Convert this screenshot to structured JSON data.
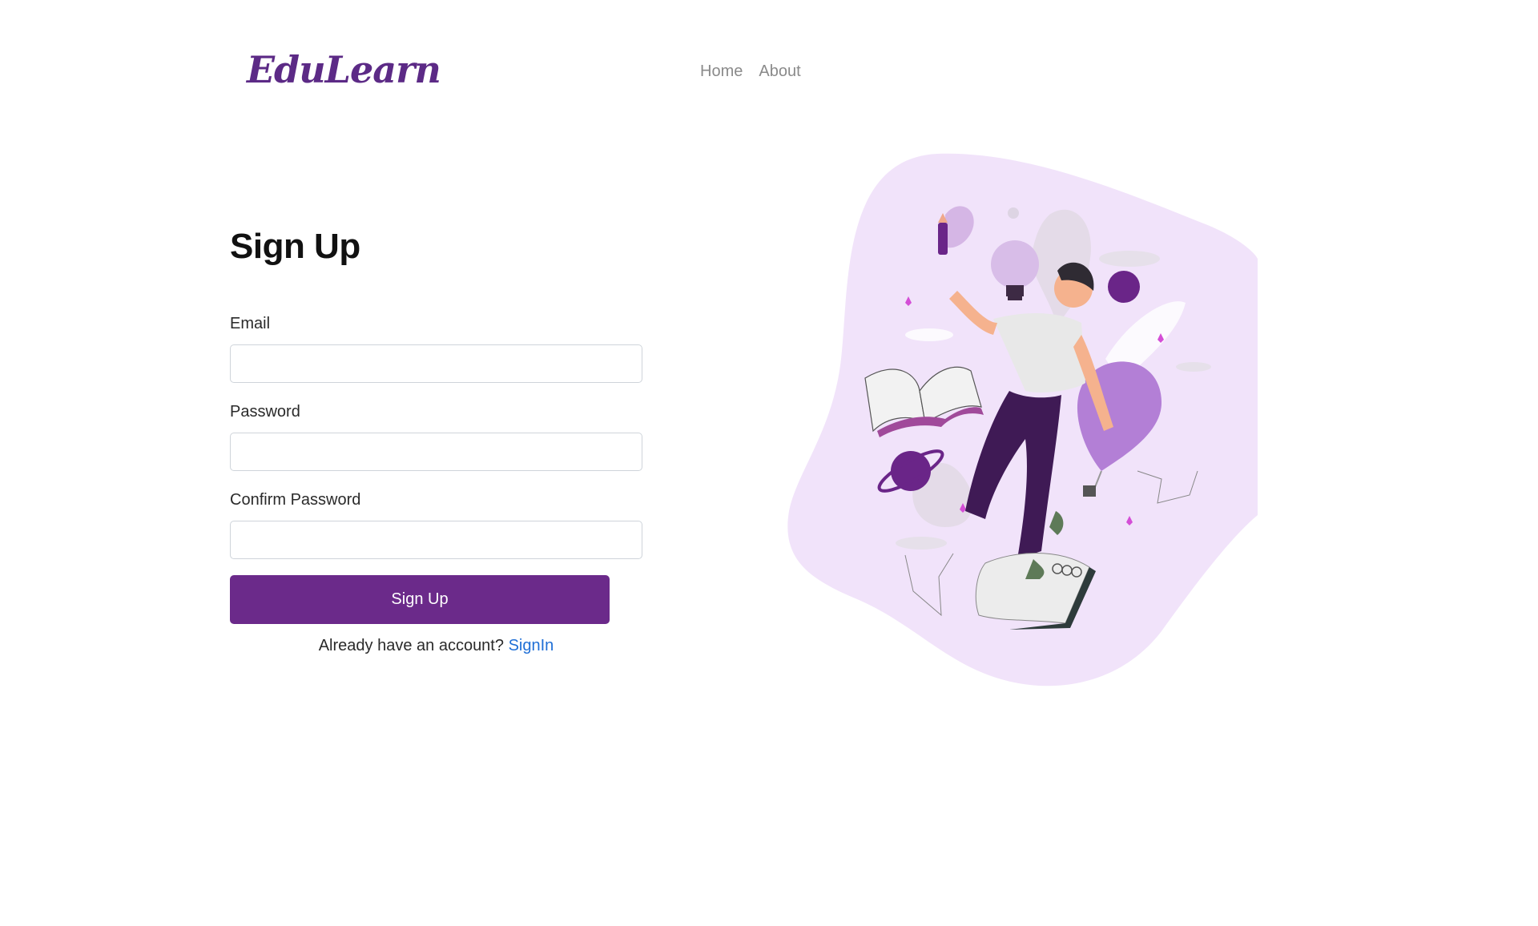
{
  "nav": {
    "brand": "EduLearn",
    "links": [
      "Home",
      "About"
    ]
  },
  "form": {
    "title": "Sign Up",
    "fields": [
      {
        "label": "Email",
        "value": "",
        "placeholder": ""
      },
      {
        "label": "Password",
        "value": "",
        "placeholder": ""
      },
      {
        "label": "Confirm Password",
        "value": "",
        "placeholder": ""
      }
    ],
    "submit_label": "Sign Up",
    "signin_prompt": "Already have an account?",
    "signin_link": "SignIn"
  },
  "colors": {
    "brand": "#5c2a86",
    "button": "#6b2a8a",
    "link": "#1f6fd6",
    "blob": "#f1e3fa",
    "accent_purple": "#6a2588"
  },
  "illustration": {
    "icon": "student-floating-with-books-illustration"
  }
}
